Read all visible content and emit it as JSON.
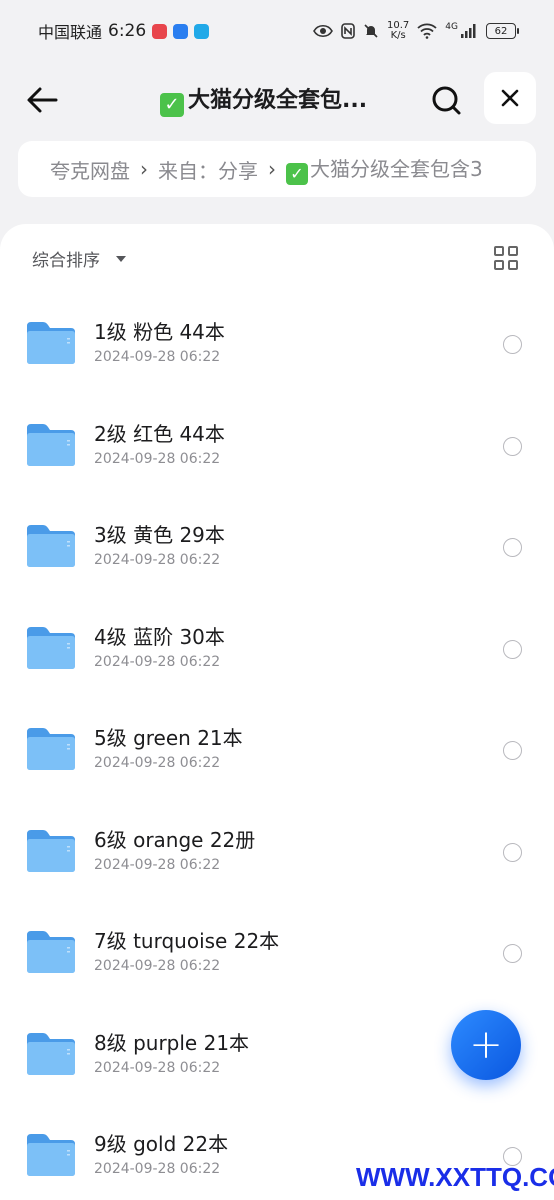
{
  "status_bar": {
    "carrier": "中国联通",
    "time": "6:26",
    "net_speed_value": "10.7",
    "net_speed_unit": "K/s",
    "signal_tag": "4G",
    "battery": "62"
  },
  "header": {
    "title": "大猫分级全套包..."
  },
  "breadcrumb": {
    "items": [
      "夸克网盘",
      "来自：分享",
      "大猫分级全套包含3"
    ]
  },
  "toolbar": {
    "sort_label": "综合排序"
  },
  "files": [
    {
      "name": "1级 粉色 44本",
      "date": "2024-09-28 06:22"
    },
    {
      "name": "2级 红色 44本",
      "date": "2024-09-28 06:22"
    },
    {
      "name": "3级 黄色 29本",
      "date": "2024-09-28 06:22"
    },
    {
      "name": "4级 蓝阶 30本",
      "date": "2024-09-28 06:22"
    },
    {
      "name": "5级 green 21本",
      "date": "2024-09-28 06:22"
    },
    {
      "name": "6级 orange 22册",
      "date": "2024-09-28 06:22"
    },
    {
      "name": "7级 turquoise 22本",
      "date": "2024-09-28 06:22"
    },
    {
      "name": "8级 purple 21本",
      "date": "2024-09-28 06:22"
    },
    {
      "name": "9级 gold 22本",
      "date": "2024-09-28 06:22"
    }
  ],
  "fab": {
    "label": "+"
  },
  "watermark": "WWW.XXTTQ.COM",
  "colors": {
    "accent": "#1E6EFF",
    "folder": "#5aa9f0",
    "check": "#4cc24a"
  }
}
